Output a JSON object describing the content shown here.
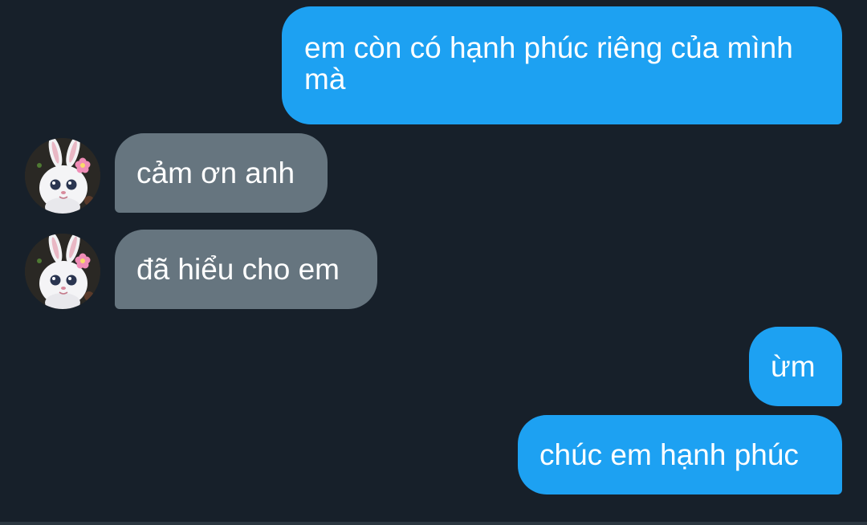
{
  "conversation": {
    "messages": [
      {
        "direction": "outgoing",
        "text": "em còn có hạnh phúc riêng của mình mà"
      },
      {
        "direction": "incoming",
        "text": "cảm ơn anh",
        "avatar": "bunny-avatar"
      },
      {
        "direction": "incoming",
        "text": "đã hiểu cho em",
        "avatar": "bunny-avatar"
      },
      {
        "direction": "outgoing",
        "text": "ừm"
      },
      {
        "direction": "outgoing",
        "text": "chúc em hạnh phúc"
      }
    ]
  },
  "colors": {
    "background": "#17202a",
    "outgoing_bubble": "#1da1f2",
    "incoming_bubble": "#66757f",
    "text": "#ffffff"
  }
}
